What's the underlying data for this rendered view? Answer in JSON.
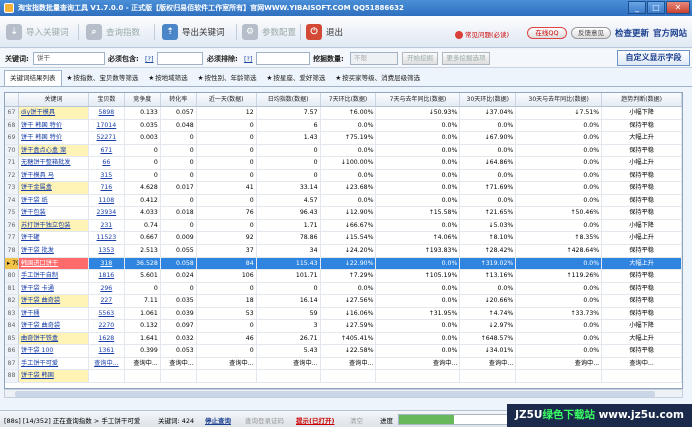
{
  "window": {
    "title": "淘宝指数批量查询工具 V1.7.0.0 - 正式版【版权归易佰软件工作室所有】官网WWW.YIBAISOFT.COM QQ51886632"
  },
  "toolbar": {
    "import_kw": "导入关键词",
    "query_index": "查询指数",
    "export_kw": "导出关键词",
    "param_config": "参数配置",
    "exit": "退出",
    "faq": "常见问题(必读)",
    "online_qq": "在线QQ",
    "feedback": "反馈意见",
    "check_update": "检查更新",
    "official_site": "官方网站"
  },
  "searchbar": {
    "keyword_label": "关键词:",
    "keyword_value": "饼干",
    "include_label": "必须包含:",
    "include_link": "[?]",
    "exclude_label": "必须排除:",
    "exclude_link": "[?]",
    "dig_count_label": "挖掘数量:",
    "dig_count_value": "不限",
    "start_dig": "开始挖掘",
    "more_dig": "更多挖掘选项",
    "custom_fields": "自定义显示字段"
  },
  "tabs": [
    {
      "star": "",
      "label": "关键词结果列表"
    },
    {
      "star": "★",
      "label": "按指数、宝贝数等筛选"
    },
    {
      "star": "★",
      "label": "按地域筛选"
    },
    {
      "star": "★",
      "label": "按性别、年龄筛选"
    },
    {
      "star": "★",
      "label": "按星座、爱好筛选"
    },
    {
      "star": "★",
      "label": "按买家等级、消费层级筛选"
    }
  ],
  "table": {
    "headers": [
      "",
      "关键词",
      "宝贝数",
      "竞争度",
      "转化率",
      "近一天(数据)",
      "日均指数(数据)",
      "7天环比(数据)",
      "7天与去年同比(数据)",
      "30天环比(数据)",
      "30天与去年同比(数据)",
      "趋势判断(数据)"
    ],
    "rows": [
      {
        "n": "67",
        "kw": "diy饼干模具",
        "items": "5898",
        "comp": "0.133",
        "conv": "0.057",
        "day": "12",
        "avg": "7.57",
        "w7": "↑6.00%",
        "y7": "↓50.93%",
        "m30": "↓37.04%",
        "y30": "↓7.51%",
        "trend": "小幅下降"
      },
      {
        "n": "68",
        "kw": "饼干 韩国 特价",
        "items": "17014",
        "comp": "0.035",
        "conv": "0.048",
        "day": "0",
        "avg": "6",
        "w7": "0.0%",
        "y7": "0.0%",
        "m30": "0.0%",
        "y30": "0.0%",
        "trend": "保持平稳"
      },
      {
        "n": "69",
        "kw": "饼干 韩国 特价",
        "items": "52271",
        "comp": "0.003",
        "conv": "0",
        "day": "0",
        "avg": "1.43",
        "w7": "↑75.19%",
        "y7": "0.0%",
        "m30": "↓67.90%",
        "y30": "0.0%",
        "trend": "大幅上升"
      },
      {
        "n": "70",
        "kw": "饼干盒点心盒 案",
        "items": "671",
        "comp": "0",
        "conv": "0",
        "day": "0",
        "avg": "0",
        "w7": "0.0%",
        "y7": "0.0%",
        "m30": "0.0%",
        "y30": "0.0%",
        "trend": "保持平稳"
      },
      {
        "n": "71",
        "kw": "无糖饼干整箱批发",
        "items": "66",
        "comp": "0",
        "conv": "0",
        "day": "0",
        "avg": "0",
        "w7": "↓100.00%",
        "y7": "0.0%",
        "m30": "↓64.86%",
        "y30": "0.0%",
        "trend": "小幅上升"
      },
      {
        "n": "72",
        "kw": "饼干模具 马",
        "items": "315",
        "comp": "0",
        "conv": "0",
        "day": "0",
        "avg": "0",
        "w7": "0.0%",
        "y7": "0.0%",
        "m30": "0.0%",
        "y30": "0.0%",
        "trend": "保持平稳"
      },
      {
        "n": "73",
        "kw": "饼干金属盒",
        "items": "716",
        "comp": "4.628",
        "conv": "0.017",
        "day": "41",
        "avg": "33.14",
        "w7": "↓23.68%",
        "y7": "0.0%",
        "m30": "↑71.69%",
        "y30": "0.0%",
        "trend": "保持平稳"
      },
      {
        "n": "74",
        "kw": "饼干袋 纸",
        "items": "1108",
        "comp": "0.412",
        "conv": "0",
        "day": "0",
        "avg": "4.57",
        "w7": "0.0%",
        "y7": "0.0%",
        "m30": "0.0%",
        "y30": "0.0%",
        "trend": "保持平稳"
      },
      {
        "n": "75",
        "kw": "饼干包装",
        "items": "23934",
        "comp": "4.033",
        "conv": "0.018",
        "day": "76",
        "avg": "96.43",
        "w7": "↓12.90%",
        "y7": "↑15.58%",
        "m30": "↑21.65%",
        "y30": "↑50.46%",
        "trend": "保持平稳"
      },
      {
        "n": "76",
        "kw": "苏打饼干独立包装",
        "items": "231",
        "comp": "0.74",
        "conv": "0",
        "day": "0",
        "avg": "1.71",
        "w7": "↓66.67%",
        "y7": "0.0%",
        "m30": "↓5.03%",
        "y30": "0.0%",
        "trend": "小幅下降"
      },
      {
        "n": "77",
        "kw": "饼干罐",
        "items": "11523",
        "comp": "0.667",
        "conv": "0.009",
        "day": "92",
        "avg": "78.86",
        "w7": "↓15.54%",
        "y7": "↑4.06%",
        "m30": "↑8.10%",
        "y30": "↑8.35%",
        "trend": "小幅上升"
      },
      {
        "n": "78",
        "kw": "饼干袋 批发",
        "items": "1353",
        "comp": "2.513",
        "conv": "0.055",
        "day": "37",
        "avg": "34",
        "w7": "↓24.20%",
        "y7": "↑193.83%",
        "m30": "↑28.42%",
        "y30": "↑428.64%",
        "trend": "保持平稳"
      },
      {
        "n": "79",
        "kw": "韩国进口饼干",
        "items": "318",
        "comp": "36.528",
        "conv": "0.058",
        "day": "84",
        "avg": "115.43",
        "w7": "↓22.90%",
        "y7": "0.0%",
        "m30": "↑319.02%",
        "y30": "0.0%",
        "trend": "大幅上升"
      },
      {
        "n": "80",
        "kw": "手工饼干自制",
        "items": "1816",
        "comp": "5.601",
        "conv": "0.024",
        "day": "106",
        "avg": "101.71",
        "w7": "↑7.29%",
        "y7": "↑105.19%",
        "m30": "↑13.16%",
        "y30": "↑119.26%",
        "trend": "保持平稳"
      },
      {
        "n": "81",
        "kw": "饼干袋 卡通",
        "items": "296",
        "comp": "0",
        "conv": "0",
        "day": "0",
        "avg": "0",
        "w7": "0.0%",
        "y7": "0.0%",
        "m30": "0.0%",
        "y30": "0.0%",
        "trend": "保持平稳"
      },
      {
        "n": "82",
        "kw": "饼干袋 曲奇袋",
        "items": "227",
        "comp": "7.11",
        "conv": "0.035",
        "day": "18",
        "avg": "16.14",
        "w7": "↓27.56%",
        "y7": "0.0%",
        "m30": "↓20.66%",
        "y30": "0.0%",
        "trend": "保持平稳"
      },
      {
        "n": "83",
        "kw": "饼干桶",
        "items": "5563",
        "comp": "1.061",
        "conv": "0.039",
        "day": "53",
        "avg": "59",
        "w7": "↓16.06%",
        "y7": "↑31.95%",
        "m30": "↑4.74%",
        "y30": "↑33.73%",
        "trend": "保持平稳"
      },
      {
        "n": "84",
        "kw": "饼干袋 曲奇袋",
        "items": "2270",
        "comp": "0.132",
        "conv": "0.097",
        "day": "0",
        "avg": "3",
        "w7": "↓27.59%",
        "y7": "0.0%",
        "m30": "↓2.97%",
        "y30": "0.0%",
        "trend": "小幅下降"
      },
      {
        "n": "85",
        "kw": "曲奇饼干铁盒",
        "items": "1628",
        "comp": "1.641",
        "conv": "0.032",
        "day": "46",
        "avg": "26.71",
        "w7": "↑405.41%",
        "y7": "0.0%",
        "m30": "↑648.57%",
        "y30": "0.0%",
        "trend": "大幅上升"
      },
      {
        "n": "86",
        "kw": "饼干袋 100",
        "items": "1361",
        "comp": "0.399",
        "conv": "0.053",
        "day": "0",
        "avg": "5.43",
        "w7": "↓22.58%",
        "y7": "0.0%",
        "m30": "↓34.01%",
        "y30": "0.0%",
        "trend": "保持平稳"
      },
      {
        "n": "87",
        "kw": "手工饼干可爱",
        "items": "查询中...",
        "comp": "查询中...",
        "conv": "查询中...",
        "day": "查询中...",
        "avg": "查询中...",
        "w7": "查询中...",
        "y7": "查询中...",
        "m30": "查询中...",
        "y30": "查询中...",
        "trend": "查询中..."
      },
      {
        "n": "88",
        "kw": "饼干袋 韩国",
        "items": "",
        "comp": "",
        "conv": "",
        "day": "",
        "avg": "",
        "w7": "",
        "y7": "",
        "m30": "",
        "y30": "",
        "trend": ""
      }
    ]
  },
  "status": {
    "progress_text": "[88s] [14/352] 正在查询指数 > 手工饼干可爱",
    "kw_count": "关键词: 424",
    "stop_query": "停止查询",
    "query_login": "查询登录证码",
    "hint": "提示(已打开)",
    "clear": "清空",
    "progress_label": "进度",
    "progress_pct": 0.5
  },
  "watermark": {
    "brand": "JZ5U",
    "green": "绿色下载站",
    "url": "www.jz5u.com"
  },
  "colors": {
    "selected_row": "#2f84e0",
    "title_bar": "#2f6fbf",
    "link": "#1a3fa8"
  }
}
